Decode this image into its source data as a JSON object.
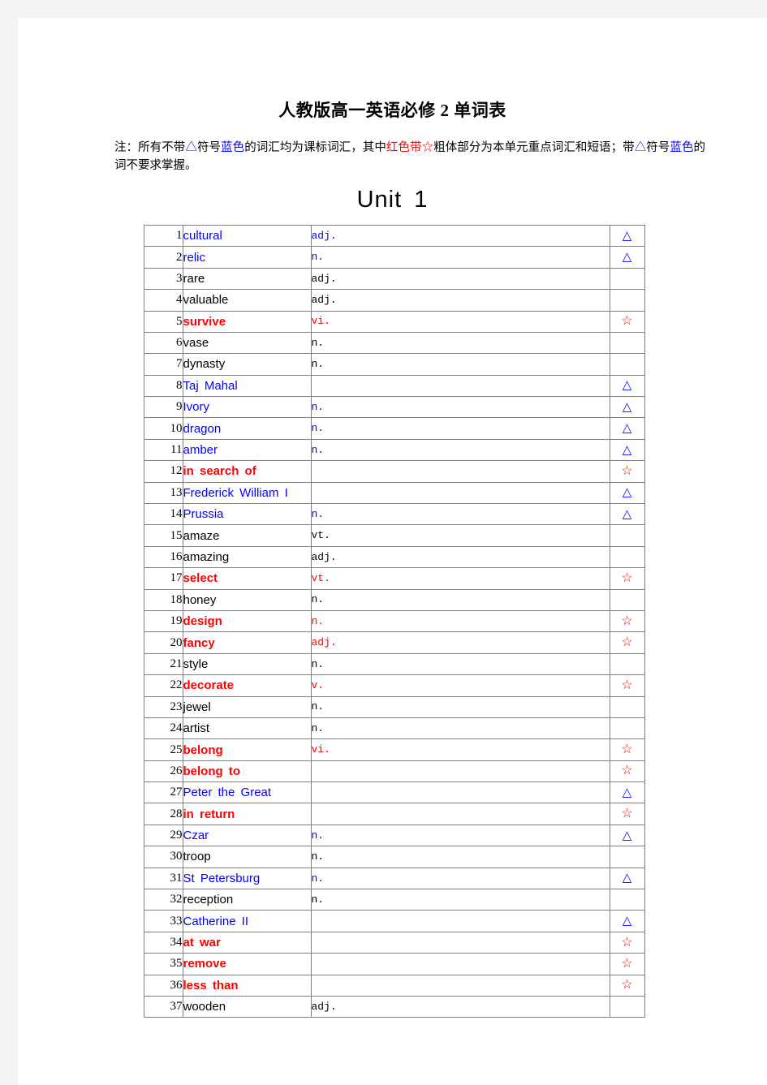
{
  "document": {
    "title": "人教版高一英语必修 2 单词表",
    "note": {
      "segments": [
        {
          "text": "注：所有不带",
          "color": "black"
        },
        {
          "text": "△",
          "color": "blue"
        },
        {
          "text": "符号",
          "color": "black"
        },
        {
          "text": "蓝色",
          "color": "blue"
        },
        {
          "text": "的词汇均为课标词汇，其中",
          "color": "black"
        },
        {
          "text": "红色带☆",
          "color": "red"
        },
        {
          "text": "粗体部分为本单元重点词汇和短语；带",
          "color": "black"
        },
        {
          "text": "△",
          "color": "blue"
        },
        {
          "text": "符号",
          "color": "black"
        },
        {
          "text": "蓝色",
          "color": "blue"
        },
        {
          "text": "的词不要求掌握。",
          "color": "black"
        }
      ]
    },
    "unit_title": "Unit 1",
    "colors": {
      "blue": "#0000FF",
      "red": "#FF0000",
      "black": "#000000",
      "border": "#808080",
      "page_background": "#FFFFFF",
      "canvas_background": "#F4F4F4"
    },
    "symbols": {
      "triangle": "△",
      "star": "☆"
    },
    "table": {
      "rows": [
        {
          "num": "1",
          "word": "cultural",
          "style": "blue",
          "pos": "adj.",
          "mark": "triangle"
        },
        {
          "num": "2",
          "word": "relic",
          "style": "blue",
          "pos": "n.",
          "mark": "triangle"
        },
        {
          "num": "3",
          "word": "rare",
          "style": "black",
          "pos": "adj.",
          "mark": ""
        },
        {
          "num": "4",
          "word": "valuable",
          "style": "black",
          "pos": "adj.",
          "mark": ""
        },
        {
          "num": "5",
          "word": "survive",
          "style": "red",
          "pos": "vi.",
          "mark": "star"
        },
        {
          "num": "6",
          "word": "vase",
          "style": "black",
          "pos": "n.",
          "mark": ""
        },
        {
          "num": "7",
          "word": "dynasty",
          "style": "black",
          "pos": "n.",
          "mark": ""
        },
        {
          "num": "8",
          "word": "Taj Mahal",
          "style": "blue",
          "pos": "",
          "mark": "triangle"
        },
        {
          "num": "9",
          "word": "Ivory",
          "style": "blue",
          "pos": "n.",
          "mark": "triangle"
        },
        {
          "num": "10",
          "word": "dragon",
          "style": "blue",
          "pos": "n.",
          "mark": "triangle"
        },
        {
          "num": "11",
          "word": "amber",
          "style": "blue",
          "pos": "n.",
          "mark": "triangle"
        },
        {
          "num": "12",
          "word": "in search of",
          "style": "red",
          "pos": "",
          "mark": "star"
        },
        {
          "num": "13",
          "word": "Frederick William I",
          "style": "blue",
          "pos": "",
          "mark": "triangle"
        },
        {
          "num": "14",
          "word": "Prussia",
          "style": "blue",
          "pos": "n.",
          "mark": "triangle"
        },
        {
          "num": "15",
          "word": "amaze",
          "style": "black",
          "pos": "vt.",
          "mark": ""
        },
        {
          "num": "16",
          "word": "amazing",
          "style": "black",
          "pos": "adj.",
          "mark": ""
        },
        {
          "num": "17",
          "word": "select",
          "style": "red",
          "pos": "vt.",
          "mark": "star"
        },
        {
          "num": "18",
          "word": "honey",
          "style": "black",
          "pos": "n.",
          "mark": ""
        },
        {
          "num": "19",
          "word": "design",
          "style": "red",
          "pos": "n.",
          "mark": "star"
        },
        {
          "num": "20",
          "word": "fancy",
          "style": "red",
          "pos": "adj.",
          "mark": "star"
        },
        {
          "num": "21",
          "word": "style",
          "style": "black",
          "pos": "n.",
          "mark": ""
        },
        {
          "num": "22",
          "word": "decorate",
          "style": "red",
          "pos": "v.",
          "mark": "star"
        },
        {
          "num": "23",
          "word": "jewel",
          "style": "black",
          "pos": "n.",
          "mark": ""
        },
        {
          "num": "24",
          "word": "artist",
          "style": "black",
          "pos": "n.",
          "mark": ""
        },
        {
          "num": "25",
          "word": "belong",
          "style": "red",
          "pos": "vi.",
          "mark": "star"
        },
        {
          "num": "26",
          "word": "belong to",
          "style": "red",
          "pos": "",
          "mark": "star"
        },
        {
          "num": "27",
          "word": "Peter the Great",
          "style": "blue",
          "pos": "",
          "mark": "triangle"
        },
        {
          "num": "28",
          "word": "in return",
          "style": "red",
          "pos": "",
          "mark": "star"
        },
        {
          "num": "29",
          "word": "Czar",
          "style": "blue",
          "pos": "n.",
          "mark": "triangle"
        },
        {
          "num": "30",
          "word": "troop",
          "style": "black",
          "pos": "n.",
          "mark": ""
        },
        {
          "num": "31",
          "word": "St Petersburg",
          "style": "blue",
          "pos": "n.",
          "mark": "triangle"
        },
        {
          "num": "32",
          "word": "reception",
          "style": "black",
          "pos": "n.",
          "mark": ""
        },
        {
          "num": "33",
          "word": "Catherine II",
          "style": "blue",
          "pos": "",
          "mark": "triangle"
        },
        {
          "num": "34",
          "word": "at war",
          "style": "red",
          "pos": "",
          "mark": "star"
        },
        {
          "num": "35",
          "word": "remove",
          "style": "red",
          "pos": "",
          "mark": "star"
        },
        {
          "num": "36",
          "word": "less than",
          "style": "red",
          "pos": "",
          "mark": "star"
        },
        {
          "num": "37",
          "word": "wooden",
          "style": "black",
          "pos": "adj.",
          "mark": ""
        }
      ]
    }
  }
}
